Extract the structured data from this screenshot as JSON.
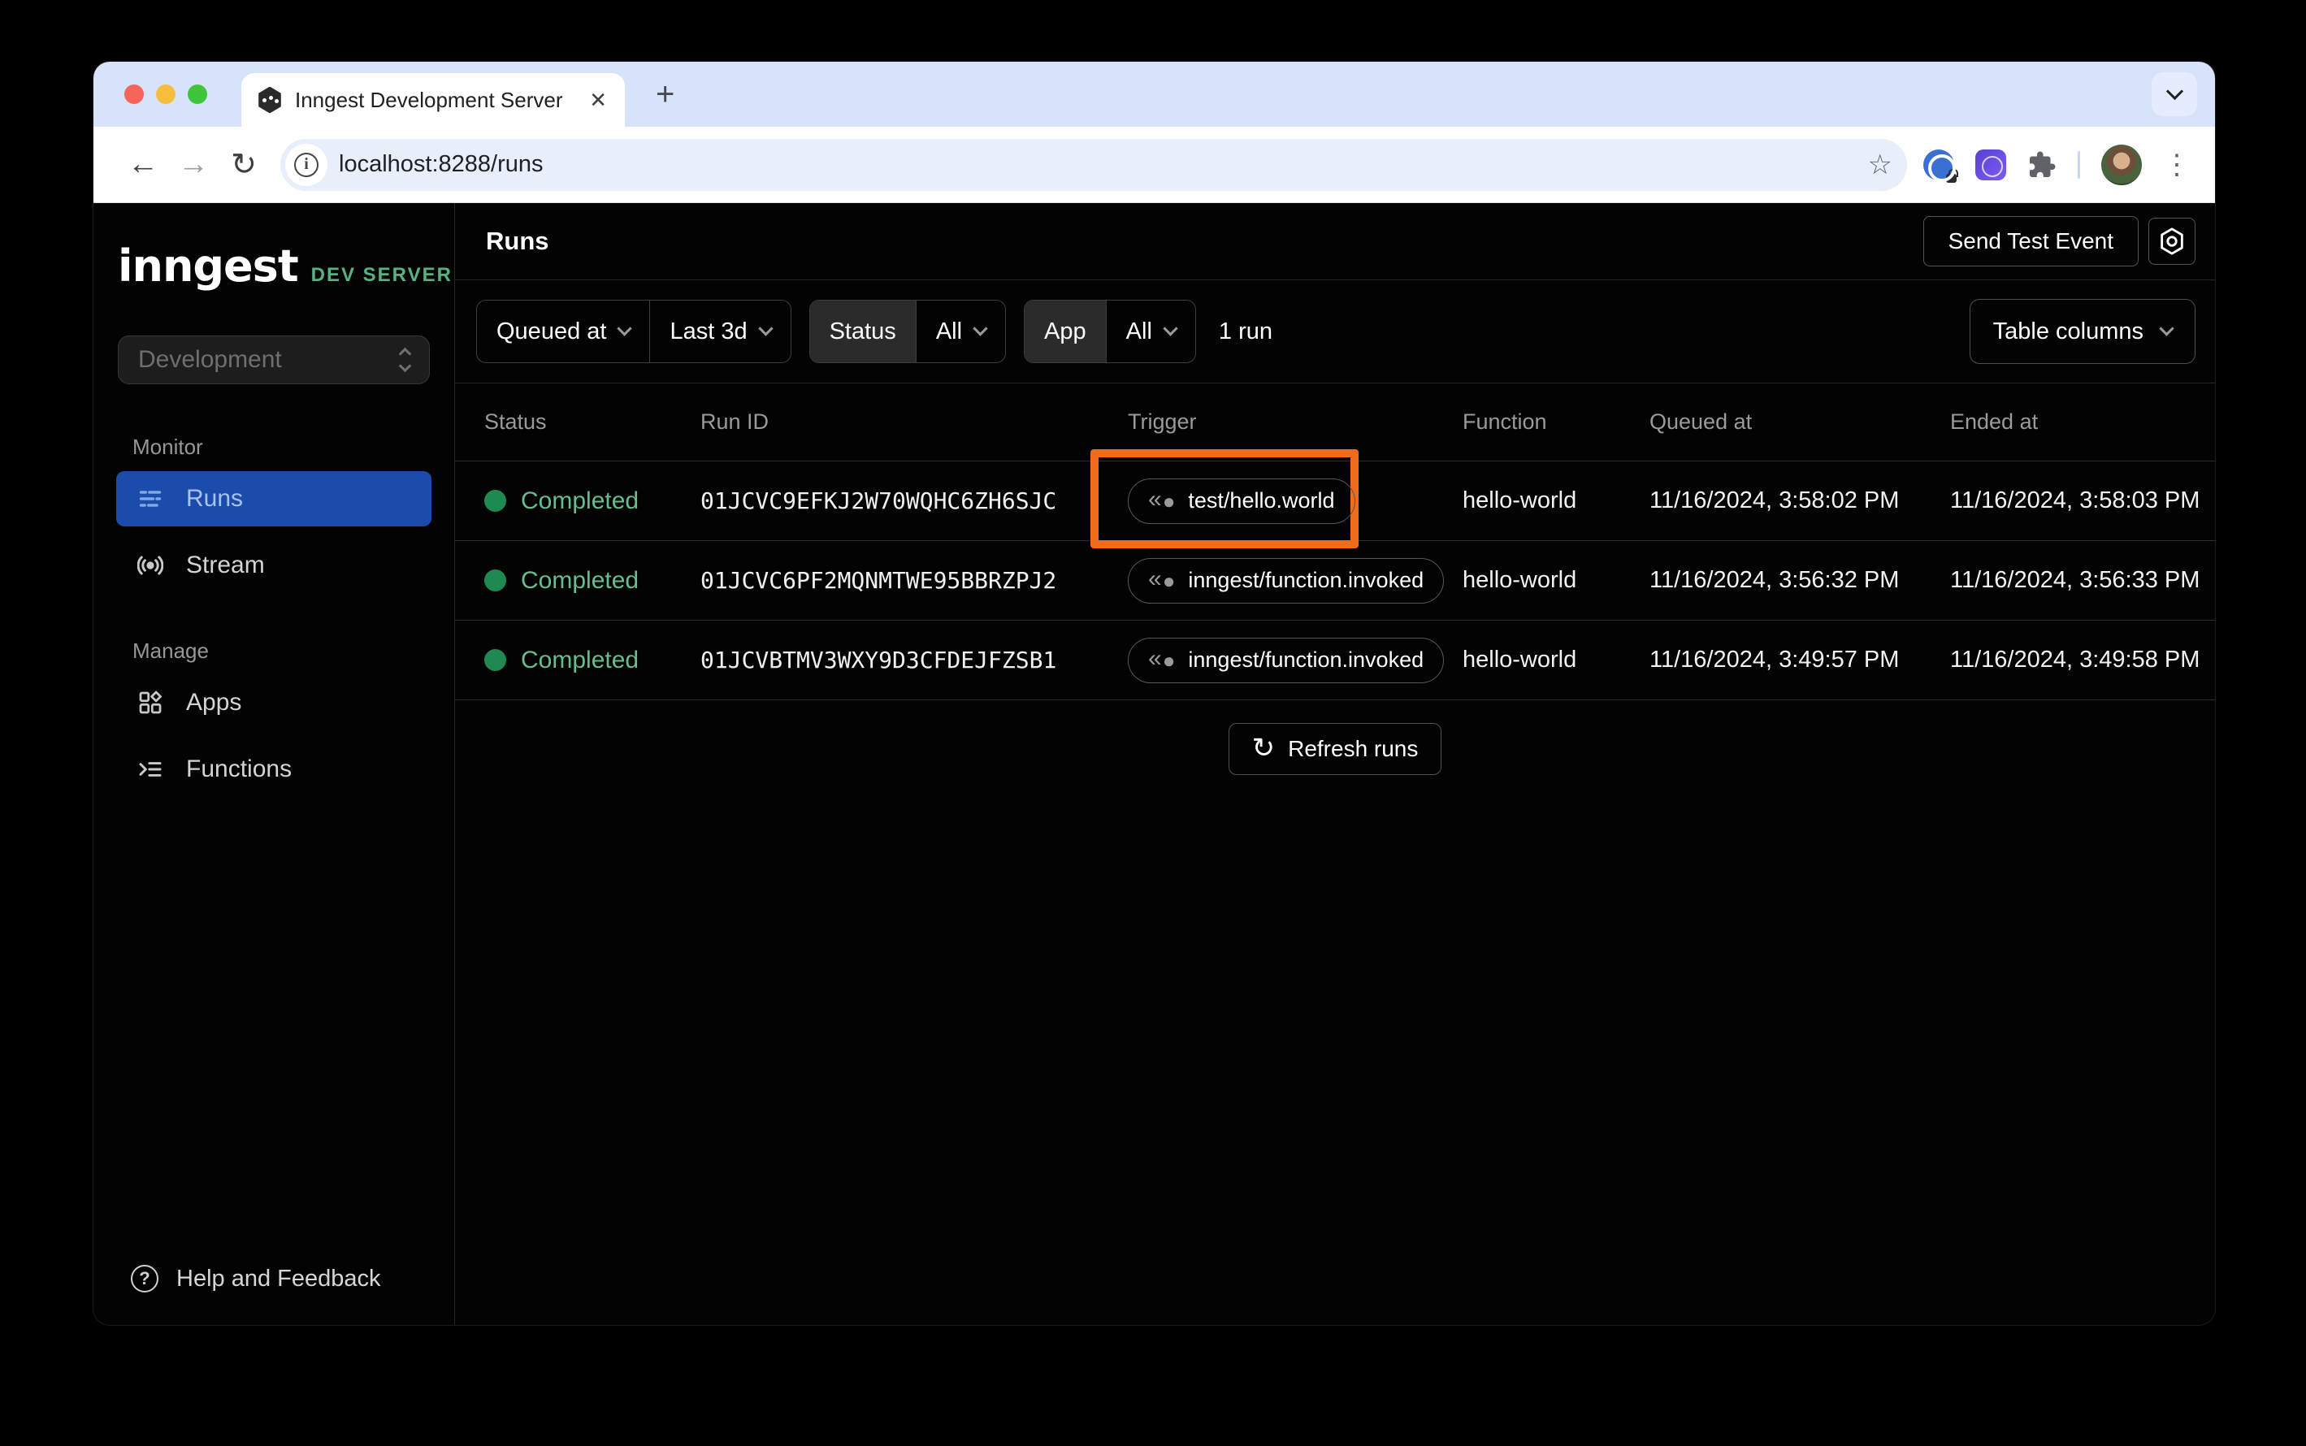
{
  "browser": {
    "tab_title": "Inngest Development Server",
    "url": "localhost:8288/runs"
  },
  "icons": {
    "back": "←",
    "forward": "→",
    "reload": "↻",
    "info": "i",
    "star": "☆",
    "more_vertical": "⋮",
    "new_tab": "+",
    "close_tab": "✕",
    "help": "?",
    "trigger_arcs": "«",
    "trigger_dot": "●",
    "refresh": "↻"
  },
  "colors": {
    "accent_blue": "#1c4cab",
    "highlight_orange": "#ee6c1b",
    "status_green": "#1e8a52",
    "status_text_green": "#66bd8d",
    "env_badge_green": "#55b383"
  },
  "sidebar": {
    "logo": "inngest",
    "env_badge": "DEV SERVER",
    "workspace_select": {
      "value": "Development"
    },
    "sections": [
      {
        "label": "Monitor",
        "items": [
          {
            "label": "Runs"
          },
          {
            "label": "Stream"
          }
        ]
      },
      {
        "label": "Manage",
        "items": [
          {
            "label": "Apps"
          },
          {
            "label": "Functions"
          }
        ]
      }
    ],
    "help_label": "Help and Feedback"
  },
  "header": {
    "title": "Runs",
    "send_test_event_label": "Send Test Event"
  },
  "filters": {
    "time_field_label": "Queued at",
    "time_range_label": "Last 3d",
    "status_label": "Status",
    "status_value": "All",
    "app_label": "App",
    "app_value": "All",
    "run_count": "1 run",
    "table_columns_label": "Table columns"
  },
  "table": {
    "columns": [
      "Status",
      "Run ID",
      "Trigger",
      "Function",
      "Queued at",
      "Ended at"
    ],
    "rows": [
      {
        "status": "Completed",
        "run_id": "01JCVC9EFKJ2W70WQHC6ZH6SJC",
        "trigger": "test/hello.world",
        "function": "hello-world",
        "queued_at": "11/16/2024, 3:58:02 PM",
        "ended_at": "11/16/2024, 3:58:03 PM",
        "highlighted": true
      },
      {
        "status": "Completed",
        "run_id": "01JCVC6PF2MQNMTWE95BBRZPJ2",
        "trigger": "inngest/function.invoked",
        "function": "hello-world",
        "queued_at": "11/16/2024, 3:56:32 PM",
        "ended_at": "11/16/2024, 3:56:33 PM",
        "highlighted": false
      },
      {
        "status": "Completed",
        "run_id": "01JCVBTMV3WXY9D3CFDEJFZSB1",
        "trigger": "inngest/function.invoked",
        "function": "hello-world",
        "queued_at": "11/16/2024, 3:49:57 PM",
        "ended_at": "11/16/2024, 3:49:58 PM",
        "highlighted": false
      }
    ]
  },
  "footer": {
    "refresh_label": "Refresh runs"
  }
}
